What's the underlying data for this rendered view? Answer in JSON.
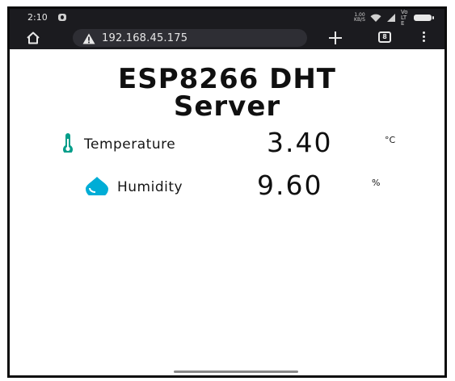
{
  "status_bar": {
    "time": "2:10",
    "net_speed": "1.00 KB/S",
    "network_label": "Vo LTE"
  },
  "browser": {
    "url": "192.168.45.175",
    "tab_count": "8"
  },
  "page": {
    "title": "ESP8266 DHT Server",
    "readings": [
      {
        "label": "Temperature",
        "value": "3.40",
        "unit": "°C",
        "icon": "thermometer-icon",
        "color": "#059e8a"
      },
      {
        "label": "Humidity",
        "value": "9.60",
        "unit": "%",
        "icon": "water-drop-icon",
        "color": "#00add6"
      }
    ]
  }
}
